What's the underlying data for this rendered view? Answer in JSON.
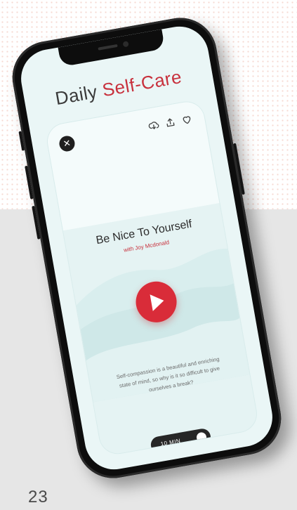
{
  "app": {
    "title_prefix": "Daily ",
    "title_accent": "Self-Care",
    "accent_color": "#c8313d"
  },
  "card": {
    "close_icon": "close-icon",
    "actions": [
      {
        "name": "cloud-download-icon"
      },
      {
        "name": "share-icon"
      },
      {
        "name": "heart-icon"
      }
    ]
  },
  "track": {
    "title": "Be Nice To Yourself",
    "subtitle": "with Joy Mcdonald",
    "description": "Self-compassion is a beautiful and enriching state of mind, so why is it so difficult to give ourselves a break?",
    "play_icon": "play-icon"
  },
  "duration": {
    "label": "10 MIN"
  },
  "page": {
    "number": "23"
  }
}
